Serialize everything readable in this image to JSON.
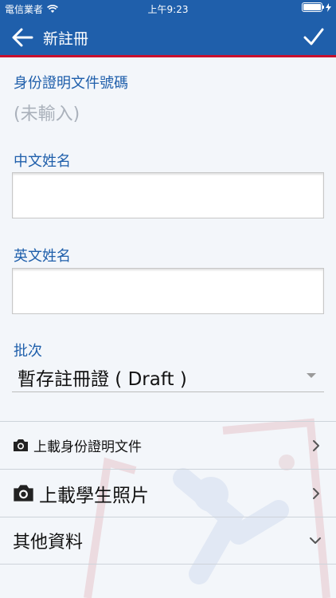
{
  "status_bar": {
    "carrier": "電信業者",
    "time": "上午9:23"
  },
  "nav": {
    "title": "新註冊"
  },
  "form": {
    "id_doc_label": "身份證明文件號碼",
    "id_doc_value": "(未輸入)",
    "chinese_name_label": "中文姓名",
    "chinese_name_value": "",
    "english_name_label": "英文姓名",
    "english_name_value": "",
    "batch_label": "批次",
    "batch_value": "暫存註冊證 ( Draft )"
  },
  "rows": {
    "upload_id": "上載身份證明文件",
    "upload_photo": "上載學生照片",
    "other_info": "其他資料"
  },
  "colors": {
    "primary": "#1f5fab",
    "accent_red": "#c8102e",
    "label_blue": "#1f5fab"
  },
  "icons": [
    "wifi-icon",
    "battery-icon",
    "back-arrow-icon",
    "checkmark-icon",
    "camera-icon",
    "chevron-right-icon",
    "chevron-down-icon"
  ]
}
